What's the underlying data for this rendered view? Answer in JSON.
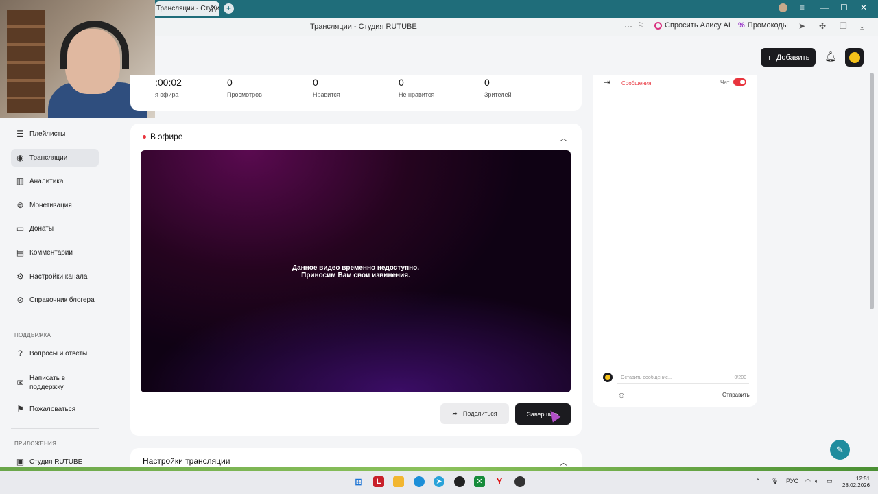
{
  "browser": {
    "tab_title": "Трансляции - Студия R",
    "page_title": "Трансляции - Студия RUTUBE",
    "ask_alice": "Спросить Алису AI",
    "promo": "Промокоды"
  },
  "header": {
    "add_label": "Добавить"
  },
  "sidebar": {
    "items": [
      {
        "label": "Плейлисты",
        "icon": "playlist-icon"
      },
      {
        "label": "Трансляции",
        "icon": "broadcast-icon",
        "active": true
      },
      {
        "label": "Аналитика",
        "icon": "analytics-icon"
      },
      {
        "label": "Монетизация",
        "icon": "monetization-icon"
      },
      {
        "label": "Донаты",
        "icon": "donate-icon"
      },
      {
        "label": "Комментарии",
        "icon": "comments-icon"
      },
      {
        "label": "Настройки канала",
        "icon": "gear-icon"
      },
      {
        "label": "Справочник блогера",
        "icon": "help-icon"
      }
    ],
    "support_title": "ПОДДЕРЖКА",
    "support_items": [
      {
        "label": "Вопросы и ответы",
        "icon": "question-icon"
      },
      {
        "label": "Написать в поддержку",
        "icon": "mail-icon"
      },
      {
        "label": "Пожаловаться",
        "icon": "flag-icon"
      }
    ],
    "apps_title": "ПРИЛОЖЕНИЯ",
    "apps_items": [
      {
        "label": "Студия RUTUBE",
        "icon": "studio-icon"
      }
    ]
  },
  "stats": [
    {
      "value": ":00:02",
      "label": "я эфира"
    },
    {
      "value": "0",
      "label": "Просмотров"
    },
    {
      "value": "0",
      "label": "Нравится"
    },
    {
      "value": "0",
      "label": "Не нравится"
    },
    {
      "value": "0",
      "label": "Зрителей"
    }
  ],
  "live": {
    "title": "В эфире",
    "video_msg_line1": "Данное видео временно недоступно.",
    "video_msg_line2": "Приносим Вам свои извинения.",
    "share_label": "Поделиться",
    "finish_label": "Завершить"
  },
  "settings": {
    "title": "Настройки трансляции"
  },
  "chat": {
    "tab_label": "Сообщения",
    "chat_label": "Чат",
    "chat_enabled": true,
    "input_placeholder": "Оставить сообщение...",
    "counter": "0/200",
    "send_label": "Отправить"
  },
  "taskbar": {
    "lang": "РУС",
    "time": "12:51",
    "date": "28.02.2026"
  },
  "colors": {
    "accent_red": "#e8343d",
    "dark_button": "#1b1b1f",
    "browser_teal": "#1f6d7a"
  }
}
